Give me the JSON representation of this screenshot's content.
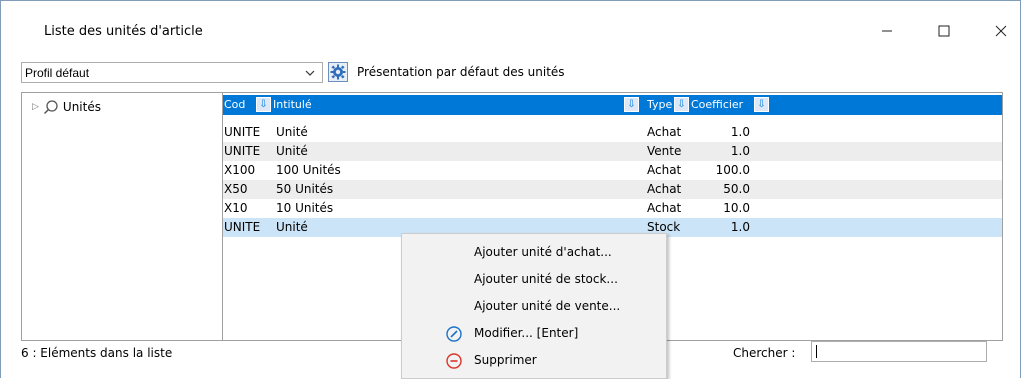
{
  "window": {
    "title": "Liste des unités d'article",
    "min_glyph": "—",
    "max_glyph": "☐",
    "close_glyph": "✕"
  },
  "toolbar": {
    "profile_value": "Profil défaut",
    "presentation_label": "Présentation par défaut des unités"
  },
  "tree": {
    "root_label": "Unités"
  },
  "table": {
    "headers": {
      "code": "Cod",
      "intitule": "Intitulé",
      "type": "Type",
      "coefficient": "Coefficier"
    },
    "rows": [
      {
        "code": "UNITE",
        "intitule": "Unité",
        "type": "Achat",
        "coef": "1.0"
      },
      {
        "code": "UNITE",
        "intitule": "Unité",
        "type": "Vente",
        "coef": "1.0"
      },
      {
        "code": "X100",
        "intitule": "100 Unités",
        "type": "Achat",
        "coef": "100.0"
      },
      {
        "code": "X50",
        "intitule": "50 Unités",
        "type": "Achat",
        "coef": "50.0"
      },
      {
        "code": "X10",
        "intitule": "10 Unités",
        "type": "Achat",
        "coef": "10.0"
      },
      {
        "code": "UNITE",
        "intitule": "Unité",
        "type": "Stock",
        "coef": "1.0"
      }
    ]
  },
  "status": {
    "count_text": "6 : Eléments dans la liste"
  },
  "search": {
    "label": "Chercher :",
    "value": ""
  },
  "context_menu": {
    "items": [
      {
        "label": "Ajouter unité d'achat..."
      },
      {
        "label": "Ajouter unité de stock..."
      },
      {
        "label": "Ajouter unité de vente..."
      },
      {
        "label": "Modifier... [Enter]",
        "icon": "edit-icon"
      },
      {
        "label": "Supprimer",
        "icon": "delete-icon"
      }
    ]
  },
  "colors": {
    "header_bg": "#0078d7",
    "selected_row": "#cce4f7",
    "alt_row": "#ededed",
    "edit_icon": "#1a73c9",
    "delete_icon": "#d9342b"
  }
}
